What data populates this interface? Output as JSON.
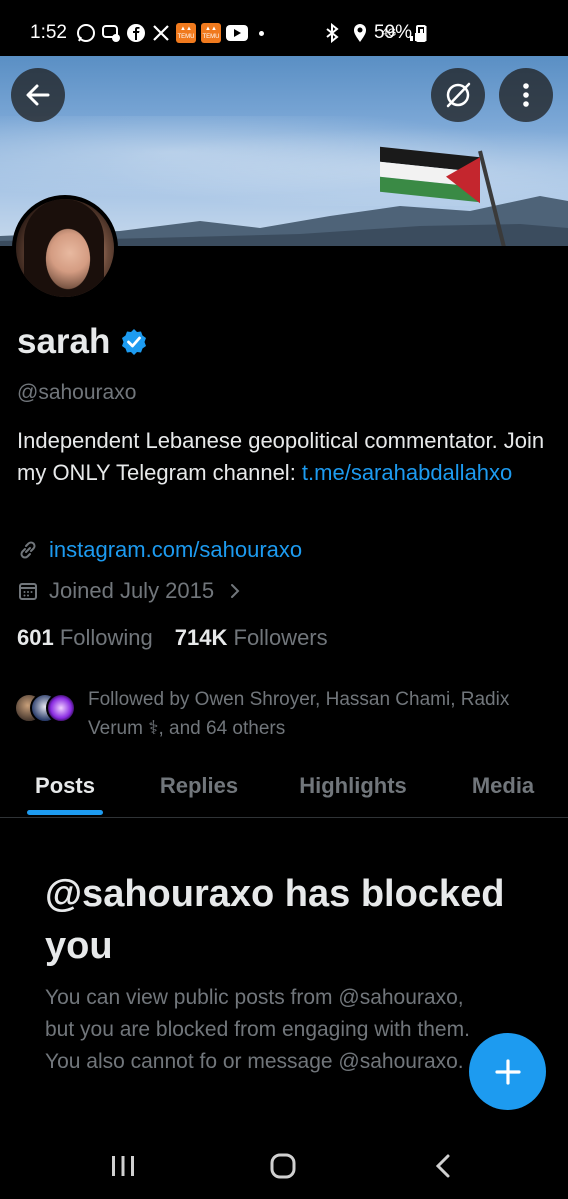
{
  "status_bar": {
    "time": "1:52",
    "battery": "59%",
    "network": "4G"
  },
  "profile": {
    "name": "sarah",
    "handle": "@sahouraxo",
    "bio_text": "Independent Lebanese geopolitical commentator.  Join my ONLY Telegram channel: ",
    "bio_link": "t.me/sarahabdallahxo",
    "website": "instagram.com/sahouraxo",
    "joined": "Joined July 2015",
    "following_count": "601",
    "following_label": "Following",
    "followers_count": "714K",
    "followers_label": "Followers",
    "followed_by": "Followed by Owen Shroyer, Hassan Chami, Radix Verum ⚕, and 64 others"
  },
  "tabs": [
    {
      "label": "Posts",
      "active": true
    },
    {
      "label": "Replies",
      "active": false
    },
    {
      "label": "Highlights",
      "active": false
    },
    {
      "label": "Media",
      "active": false
    }
  ],
  "blocked": {
    "title": "@sahouraxo has blocked you",
    "body": "You can view public posts from @sahouraxo, but you are blocked from engaging with them. You also cannot fo or message @sahouraxo."
  },
  "colors": {
    "accent": "#1d9bf0",
    "background": "#000000",
    "secondary_text": "#71767b"
  },
  "icons": {
    "back": "arrow-left-icon",
    "hide": "eye-slash-icon",
    "more": "more-vertical-icon",
    "verified": "verified-badge-icon",
    "link": "link-icon",
    "calendar": "calendar-icon",
    "fab": "plus-icon"
  }
}
